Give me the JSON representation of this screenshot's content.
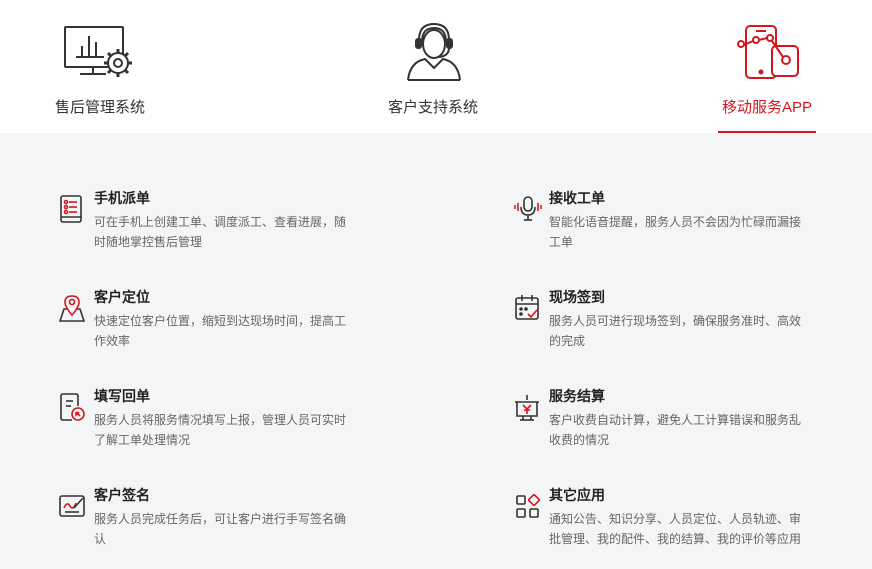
{
  "tabs": [
    {
      "label": "售后管理系统",
      "icon": "monitor-gear-icon",
      "active": false
    },
    {
      "label": "客户支持系统",
      "icon": "headset-agent-icon",
      "active": false
    },
    {
      "label": "移动服务APP",
      "icon": "mobile-app-icon",
      "active": true
    }
  ],
  "colors": {
    "accent": "#d7151e",
    "panel_bg": "#f4f5f6",
    "icon_dark": "#333333"
  },
  "features": [
    {
      "title": "手机派单",
      "desc": "可在手机上创建工单、调度派工、查看进展，随时随地掌控售后管理",
      "icon": "phone-list-icon"
    },
    {
      "title": "接收工单",
      "desc": "智能化语音提醒，服务人员不会因为忙碌而漏接工单",
      "icon": "microphone-voice-icon"
    },
    {
      "title": "客户定位",
      "desc": "快速定位客户位置，缩短到达现场时间，提高工作效率",
      "icon": "map-pin-icon"
    },
    {
      "title": "现场签到",
      "desc": "服务人员可进行现场签到，确保服务准时、高效的完成",
      "icon": "calendar-check-icon"
    },
    {
      "title": "填写回单",
      "desc": "服务人员将服务情况填写上报，管理人员可实时了解工单处理情况",
      "icon": "form-edit-icon"
    },
    {
      "title": "服务结算",
      "desc": "客户收费自动计算，避免人工计算错误和服务乱收费的情况",
      "icon": "yen-settlement-icon"
    },
    {
      "title": "客户签名",
      "desc": "服务人员完成任务后，可让客户进行手写签名确认",
      "icon": "signature-icon"
    },
    {
      "title": "其它应用",
      "desc": "通知公告、知识分享、人员定位、人员轨迹、审批管理、我的配件、我的结算、我的评价等应用",
      "icon": "apps-grid-icon"
    }
  ]
}
